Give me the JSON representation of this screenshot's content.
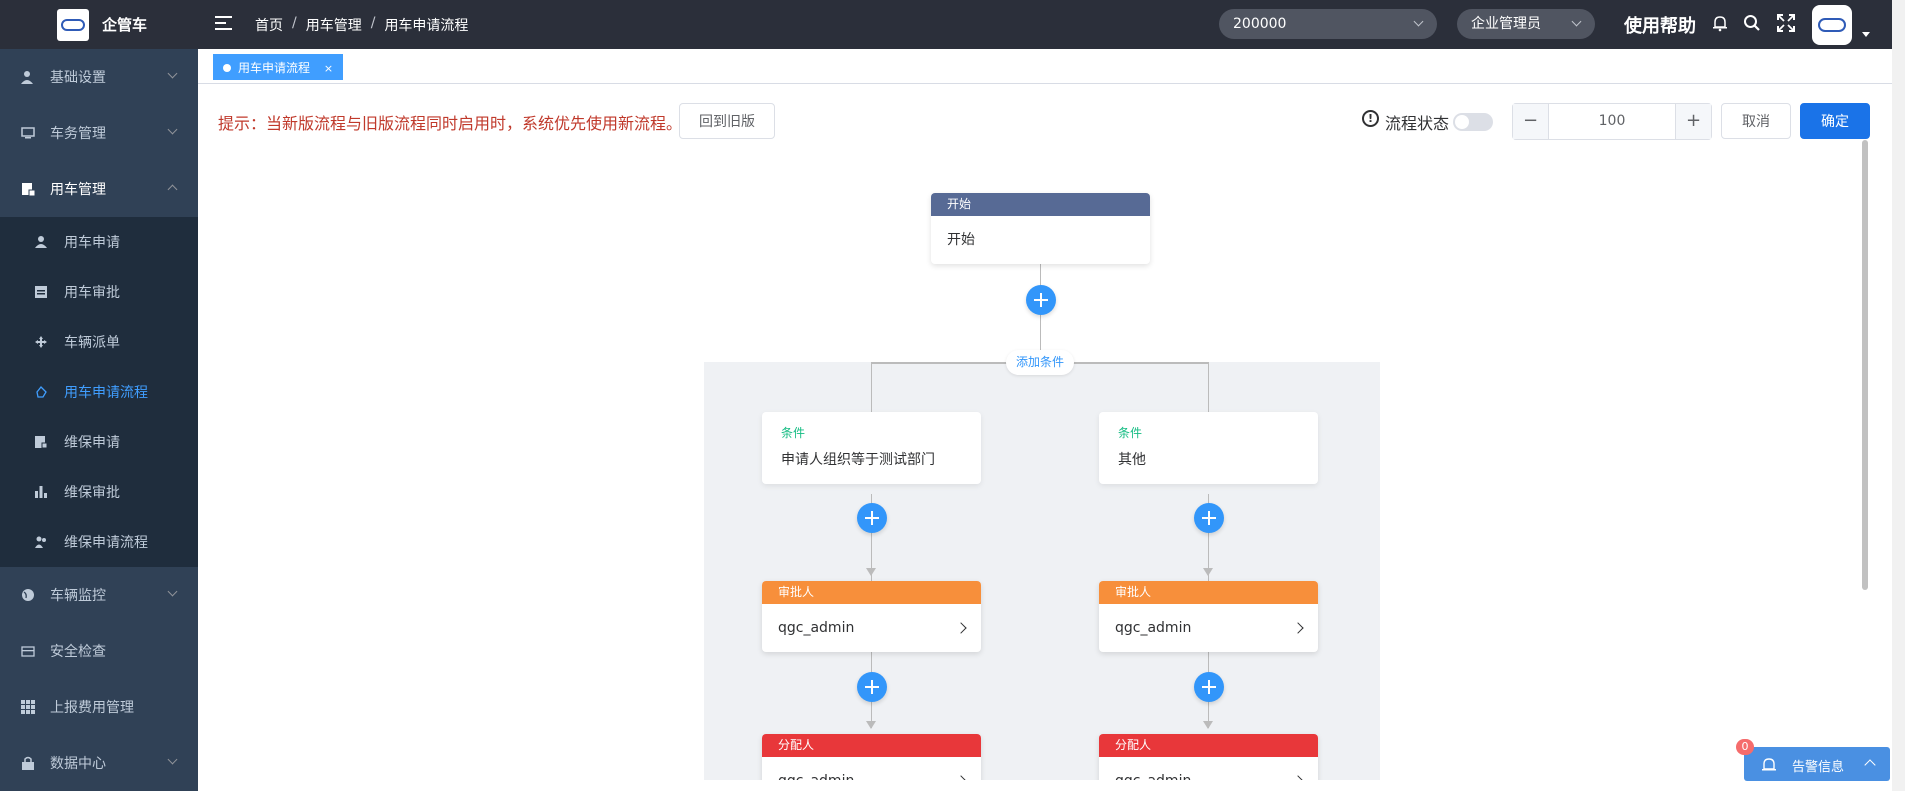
{
  "app": {
    "title": "企管车"
  },
  "sidebar": {
    "items": [
      {
        "label": "基础设置",
        "icon": "user-settings-icon"
      },
      {
        "label": "车务管理",
        "icon": "monitor-icon"
      },
      {
        "label": "用车管理",
        "icon": "document-icon"
      },
      {
        "label": "车辆监控",
        "icon": "globe-icon"
      },
      {
        "label": "安全检查",
        "icon": "card-icon"
      },
      {
        "label": "上报费用管理",
        "icon": "grid-icon"
      },
      {
        "label": "数据中心",
        "icon": "lock-icon"
      }
    ],
    "submenu": [
      {
        "label": "用车申请",
        "icon": "user-icon"
      },
      {
        "label": "用车审批",
        "icon": "form-icon"
      },
      {
        "label": "车辆派单",
        "icon": "move-icon"
      },
      {
        "label": "用车申请流程",
        "icon": "flow-icon"
      },
      {
        "label": "维保申请",
        "icon": "form-icon"
      },
      {
        "label": "维保审批",
        "icon": "bar-chart-icon"
      },
      {
        "label": "维保申请流程",
        "icon": "users-icon"
      }
    ]
  },
  "header": {
    "breadcrumb": [
      "首页",
      "用车管理",
      "用车申请流程"
    ],
    "separator": "/",
    "org_select": "200000",
    "role_select": "企业管理员",
    "help": "使用帮助"
  },
  "tags": [
    {
      "label": "用车申请流程",
      "close": "×"
    }
  ],
  "toolbar": {
    "tip": "提示：当新版流程与旧版流程同时启用时，系统优先使用新流程。",
    "back_old": "回到旧版",
    "status_label": "流程状态",
    "status_icon": "!",
    "status_on": false,
    "zoom": "100",
    "minus": "−",
    "plus": "+",
    "cancel": "取消",
    "confirm": "确定"
  },
  "flow": {
    "start": {
      "header": "开始",
      "body": "开始",
      "color": "#576a95"
    },
    "add_condition": "添加条件",
    "conditions": [
      {
        "title": "条件",
        "value": "申请人组织等于测试部门"
      },
      {
        "title": "条件",
        "value": "其他"
      }
    ],
    "approver": {
      "header": "审批人",
      "body": "qgc_admin",
      "color": "#f78f3b"
    },
    "assigner": {
      "header": "分配人",
      "body": "qgc_admin",
      "color": "#e8373a"
    }
  },
  "alert": {
    "label": "告警信息",
    "count": "0"
  }
}
